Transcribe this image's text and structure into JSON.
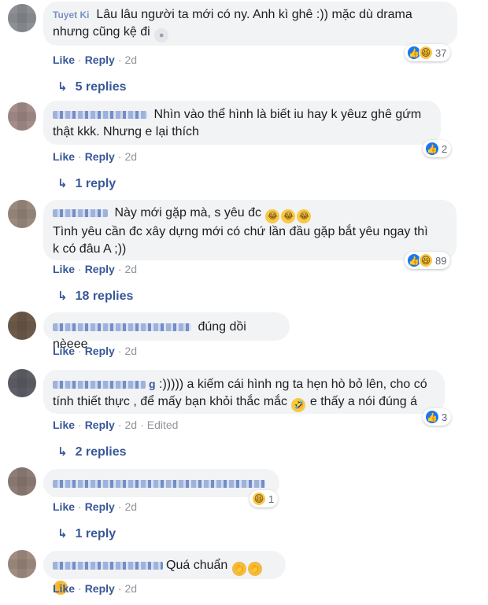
{
  "comments": [
    {
      "name": "Tuyet Ki",
      "text_line1": "Lâu lâu người ta mới có ny. Anh kì ghê :)) mặc dù drama",
      "text_line2": "nhưng cũng kệ đi",
      "actions": {
        "like": "Like",
        "reply": "Reply",
        "time": "2d"
      },
      "reaction_count": "37",
      "replies": "5 replies"
    },
    {
      "text_line1": "Nhìn vào thể hình là biết iu hay k yêuz ghê gứm",
      "text_line2": "thật kkk. Nhưng e lại thích",
      "actions": {
        "like": "Like",
        "reply": "Reply",
        "time": "2d"
      },
      "reaction_count": "2",
      "replies": "1 reply"
    },
    {
      "text_line1": "Này mới gặp mà, s yêu đc",
      "text_line2": "Tình yêu cần đc xây dựng mới có chứ lần đầu gặp bắt yêu ngay thì",
      "text_line3": "k có đâu A ;))",
      "actions": {
        "like": "Like",
        "reply": "Reply",
        "time": "2d"
      },
      "reaction_count": "89",
      "replies": "18 replies"
    },
    {
      "text_line1": "đúng dồi nèeee",
      "actions": {
        "like": "Like",
        "reply": "Reply",
        "time": "2d"
      }
    },
    {
      "name_tail": "g",
      "text_line1": ":))))) a kiếm cái hình ng ta hẹn hò bỏ lên, cho có",
      "text_line2a": "tính thiết thực , để mấy bạn khỏi thắc mắc",
      "text_line2b": "e thấy a nói đúng á",
      "actions": {
        "like": "Like",
        "reply": "Reply",
        "time": "2d",
        "edited": "Edited"
      },
      "reaction_count": "3",
      "replies": "2 replies"
    },
    {
      "actions": {
        "like": "Like",
        "reply": "Reply",
        "time": "2d"
      },
      "reaction_count": "1",
      "replies": "1 reply"
    },
    {
      "text_line1": "Quá chuẩn",
      "actions": {
        "like": "Like",
        "reply": "Reply",
        "time": "2d"
      }
    }
  ],
  "colors": {
    "link": "#385898",
    "bubble": "#f2f3f5",
    "meta": "#90949c",
    "like": "#1877f2",
    "haha": "#f7c948"
  },
  "icons": [
    "like-icon",
    "haha-icon",
    "reply-arrow-icon",
    "clap-emoji",
    "laugh-emoji",
    "moon-emoji",
    "rofl-emoji"
  ]
}
